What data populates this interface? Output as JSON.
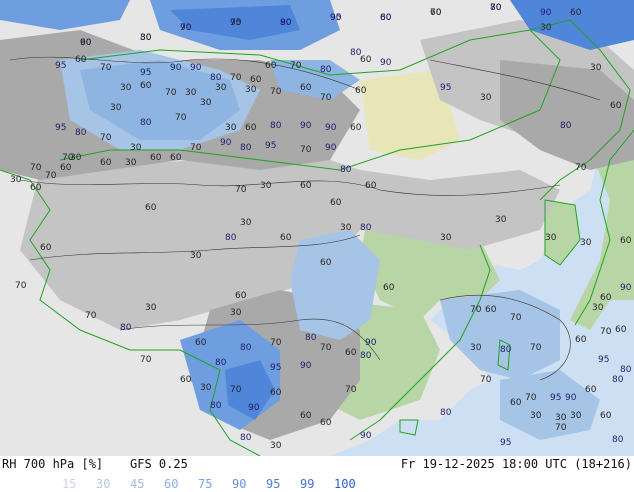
{
  "header": {
    "parameter": "RH 700 hPa [%]",
    "model": "GFS 0.25",
    "valid_time": "Fr 19-12-2025 18:00 UTC (18+216)"
  },
  "legend": {
    "levels": [
      {
        "label": "15",
        "color": "#c8d4e8"
      },
      {
        "label": "30",
        "color": "#b4c8e6"
      },
      {
        "label": "45",
        "color": "#a0bce4"
      },
      {
        "label": "60",
        "color": "#8cb0e4"
      },
      {
        "label": "75",
        "color": "#78a4e4"
      },
      {
        "label": "90",
        "color": "#6496e0"
      },
      {
        "label": "95",
        "color": "#4b82dc"
      },
      {
        "label": "99",
        "color": "#3c6ed8"
      },
      {
        "label": "100",
        "color": "#2f5ad0"
      }
    ]
  },
  "map": {
    "contour_labels": [
      "90",
      "80",
      "70",
      "95",
      "80",
      "90",
      "60",
      "70",
      "80",
      "90",
      "60",
      "95",
      "60",
      "70",
      "95",
      "90",
      "90",
      "80",
      "70",
      "60",
      "60",
      "70",
      "80",
      "80",
      "60",
      "90",
      "30",
      "60",
      "70",
      "30",
      "30",
      "30",
      "70",
      "60",
      "70",
      "60",
      "95",
      "30",
      "30",
      "80",
      "70",
      "30",
      "30",
      "60",
      "80",
      "90",
      "90",
      "60",
      "95",
      "80",
      "70",
      "30",
      "60",
      "60",
      "70",
      "90",
      "80",
      "95",
      "70",
      "90",
      "80",
      "60",
      "70",
      "30",
      "60",
      "60",
      "30",
      "60",
      "70",
      "70",
      "30",
      "60",
      "30",
      "60",
      "30",
      "60",
      "30",
      "80",
      "30",
      "30",
      "30",
      "30",
      "60",
      "70",
      "30",
      "30",
      "60",
      "30",
      "60",
      "70",
      "80",
      "60",
      "80",
      "80",
      "70",
      "80",
      "70",
      "60",
      "90",
      "60",
      "70",
      "60",
      "70",
      "30",
      "80",
      "70",
      "60",
      "70",
      "60",
      "30",
      "70",
      "60",
      "30",
      "80",
      "70",
      "90",
      "60",
      "90",
      "95",
      "80",
      "30",
      "60",
      "60",
      "70",
      "80",
      "70",
      "60",
      "70",
      "95",
      "90",
      "60",
      "30",
      "70",
      "30",
      "60",
      "80",
      "80",
      "95",
      "90",
      "60",
      "30",
      "90",
      "80",
      "95",
      "80",
      "30",
      "30",
      "60",
      "70",
      "80",
      "60",
      "70",
      "60",
      "80",
      "60",
      "30",
      "90",
      "70",
      "90",
      "95",
      "80",
      "60",
      "70"
    ],
    "colors": {
      "ocean": "#cde0f3",
      "land_dry": "#e6e6e6",
      "terrain_low": "#b8d5a5",
      "terrain_desert": "#e8e5b8",
      "terrain_high": "#c8ad78",
      "rh_30": "#c4c4c4",
      "rh_60": "#a9a9a9",
      "rh_70": "#a6c4e6",
      "rh_80": "#8eb4e2",
      "rh_90": "#6f9ee0",
      "rh_95": "#4f86da",
      "coastline": "#1fa31f",
      "contour": "#333333"
    }
  }
}
